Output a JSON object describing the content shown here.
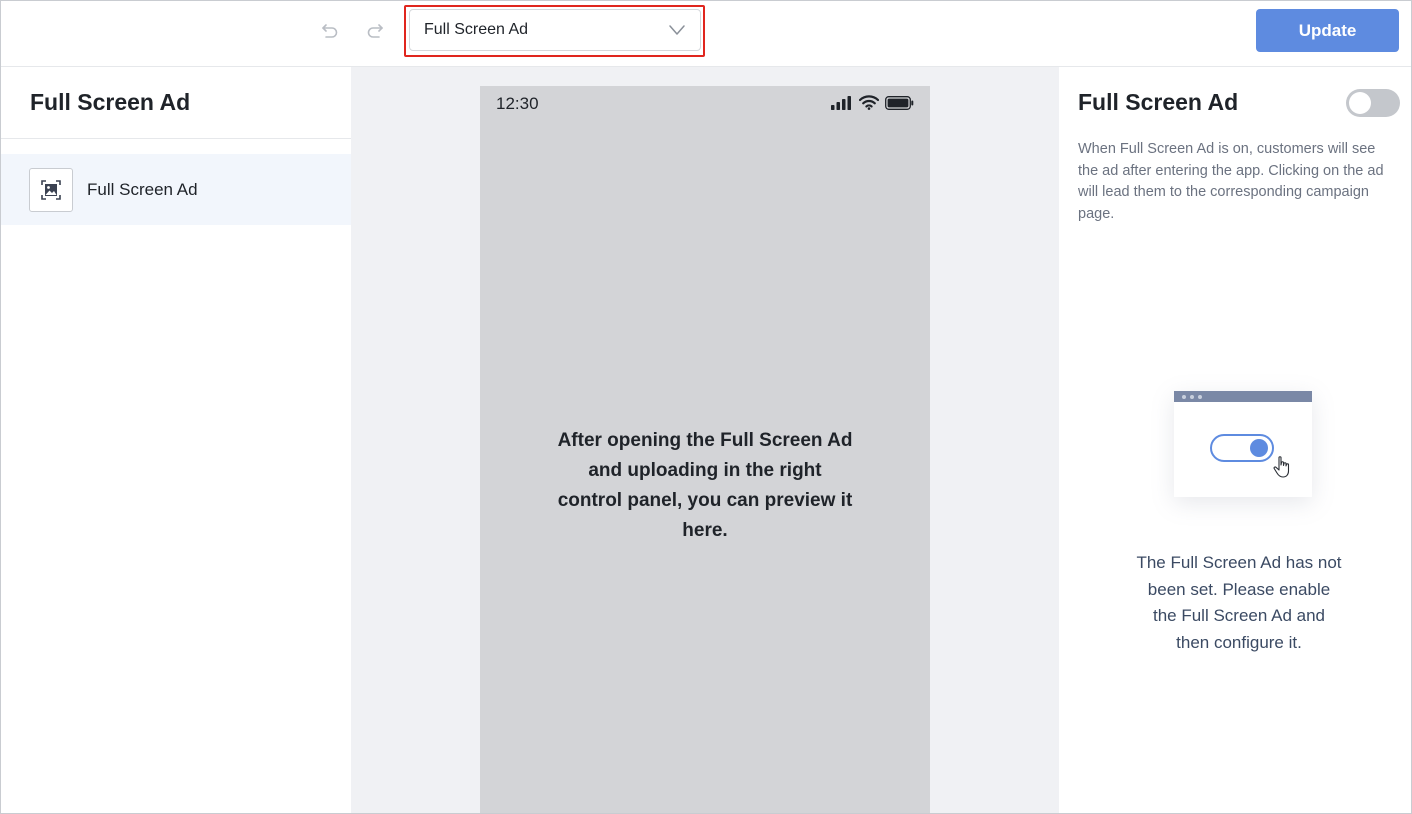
{
  "toolbar": {
    "page_select_value": "Full Screen Ad",
    "update_label": "Update"
  },
  "left_panel": {
    "title": "Full Screen Ad",
    "items": [
      {
        "label": "Full Screen Ad",
        "icon": "image-icon",
        "selected": true
      }
    ]
  },
  "preview": {
    "status_time": "12:30",
    "message": "After opening the Full Screen Ad and uploading in the right control panel, you can preview it here."
  },
  "right_panel": {
    "title": "Full Screen Ad",
    "toggle_on": false,
    "description": "When Full Screen Ad is on, customers will see the ad after entering the app. Clicking on the ad will lead them to the corresponding campaign page.",
    "empty_message": "The Full Screen Ad has not been set. Please enable the Full Screen Ad and then configure it."
  },
  "colors": {
    "accent": "#5e8be0",
    "highlight": "#e0261e",
    "toggle_off": "#c4c7cc",
    "phone_bg": "#d3d4d7",
    "canvas_bg": "#f0f1f4"
  }
}
